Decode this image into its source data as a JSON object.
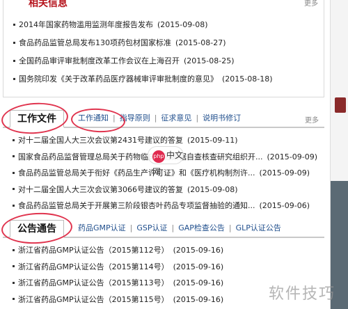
{
  "top": {
    "title": "相关信息",
    "more": "更多",
    "items": [
      {
        "text": "2014年国家药物滥用监测年度报告发布",
        "date": "(2015-09-08)"
      },
      {
        "text": "食品药品监管总局发布130项药包材国家标准",
        "date": "(2015-08-27)"
      },
      {
        "text": "全国药品审评审批制度改革工作会议在上海召开",
        "date": "(2015-08-25)"
      },
      {
        "text": "国务院印发《关于改革药品医疗器械审评审批制度的意见》",
        "date": "(2015-08-18)"
      }
    ]
  },
  "work": {
    "tab": "工作文件",
    "links": [
      "工作通知",
      "指导原则",
      "征求意见",
      "说明书修订"
    ],
    "more": "更多",
    "items": [
      {
        "text": "对十二届全国人大三次会议第2431号建议的答复",
        "date": "(2015-09-11)"
      },
      {
        "text": "国家食品药品监督管理总局关于药物临床试验数据自查核查研究组织开...",
        "date": "(2015-09-09)"
      },
      {
        "text": "食品药品监管总局关于衔好《药品生产许可证》和《医疗机构制剂许...",
        "date": "(2015-09-09)"
      },
      {
        "text": "对十二届全国人大三次会议第3066号建议的答复",
        "date": "(2015-09-08)"
      },
      {
        "text": "食品药品监管总局关于开展第三阶段银杏叶药品专项监督抽验的通知...",
        "date": "(2015-09-06)"
      }
    ]
  },
  "notice": {
    "tab": "公告通告",
    "links": [
      "药品GMP认证",
      "GSP认证",
      "GAP检查公告",
      "GLP认证公告"
    ],
    "items": [
      {
        "text": "浙江省药品GMP认证公告（2015第112号）",
        "date": "(2015-09-16)"
      },
      {
        "text": "浙江省药品GMP认证公告（2015第114号）",
        "date": "(2015-09-16)"
      },
      {
        "text": "浙江省药品GMP认证公告（2015第113号）",
        "date": "(2015-09-16)"
      },
      {
        "text": "浙江省药品GMP认证公告（2015第115号）",
        "date": "(2015-09-16)"
      }
    ]
  },
  "overlay": {
    "badge_icon": "php",
    "badge_text": "中文网",
    "watermark": "软件技巧"
  },
  "colors": {
    "accent": "#b5121b",
    "link": "#1f4e8c",
    "annotation": "#e0344e"
  }
}
